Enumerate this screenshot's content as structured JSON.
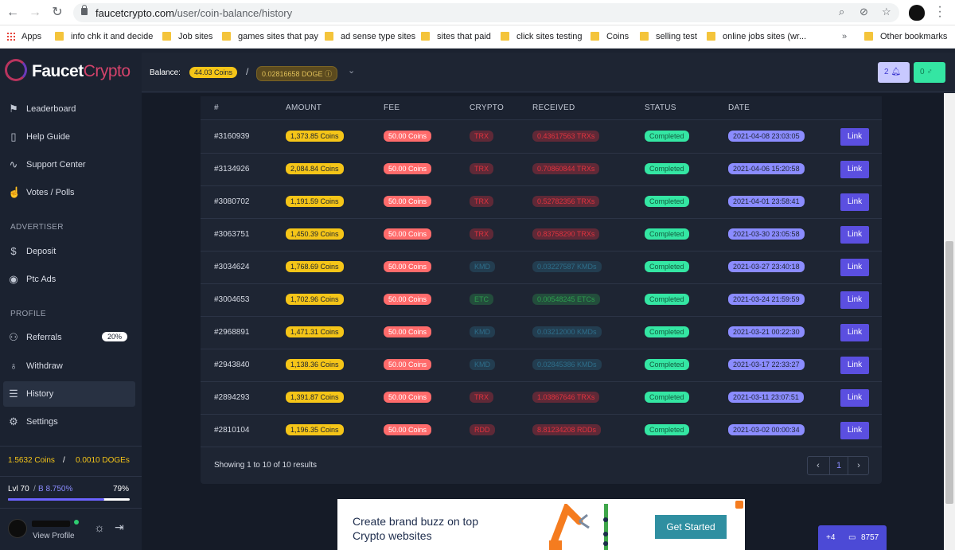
{
  "browser": {
    "url_domain": "faucetcrypto.com",
    "url_path": "/user/coin-balance/history",
    "bookmarks": [
      {
        "label": "Apps",
        "type": "apps"
      },
      {
        "label": "info chk it and decide",
        "type": "folder"
      },
      {
        "label": "Job sites",
        "type": "folder"
      },
      {
        "label": "games sites that pay",
        "type": "folder"
      },
      {
        "label": "ad sense type sites",
        "type": "folder"
      },
      {
        "label": "sites that paid",
        "type": "folder"
      },
      {
        "label": "click sites testing",
        "type": "folder"
      },
      {
        "label": "Coins",
        "type": "folder"
      },
      {
        "label": "selling test",
        "type": "folder"
      },
      {
        "label": "online jobs sites (wr...",
        "type": "folder"
      },
      {
        "label": "Other bookmarks",
        "type": "folder"
      }
    ],
    "more_label": "»"
  },
  "logo": {
    "part1": "Faucet",
    "part2": "Crypto"
  },
  "sidebar": {
    "items": [
      {
        "label": "Leaderboard",
        "icon": "flag-icon"
      },
      {
        "label": "Help Guide",
        "icon": "book-icon"
      },
      {
        "label": "Support Center",
        "icon": "activity-icon"
      },
      {
        "label": "Votes / Polls",
        "icon": "thumbs-up-icon"
      }
    ],
    "advertiser_heading": "ADVERTISER",
    "advertiser_items": [
      {
        "label": "Deposit",
        "icon": "dollar-icon"
      },
      {
        "label": "Ptc Ads",
        "icon": "eye-icon"
      }
    ],
    "profile_heading": "PROFILE",
    "profile_items": [
      {
        "label": "Referrals",
        "icon": "users-icon",
        "badge": "20%"
      },
      {
        "label": "Withdraw",
        "icon": "award-icon"
      },
      {
        "label": "History",
        "icon": "database-icon",
        "active": true
      },
      {
        "label": "Settings",
        "icon": "gear-icon"
      }
    ],
    "coins_text": "1.5632 Coins",
    "coins_sep": "/",
    "doge_text": "0.0010 DOGEs",
    "level_text": "Lvl 70",
    "level_sep": "/",
    "bonus_text": "B 8.750%",
    "level_percent": "79%",
    "level_progress": 0.79,
    "view_profile": "View Profile"
  },
  "topbar": {
    "balance_label": "Balance:",
    "coins_pill": "44.03 Coins",
    "separator": "/",
    "doge_pill": "0.02816658 DOGE",
    "notif_count": "2",
    "msg_count": "0"
  },
  "table": {
    "headers": [
      "#",
      "AMOUNT",
      "FEE",
      "CRYPTO",
      "RECEIVED",
      "STATUS",
      "DATE"
    ],
    "rows": [
      {
        "id": "#3160939",
        "amount": "1,373.85 Coins",
        "fee": "50.00 Coins",
        "crypto": "TRX",
        "received": "0.43617563 TRXs",
        "status": "Completed",
        "date": "2021-04-08 23:03:05",
        "link": "Link",
        "color": "#e0333f"
      },
      {
        "id": "#3134926",
        "amount": "2,084.84 Coins",
        "fee": "50.00 Coins",
        "crypto": "TRX",
        "received": "0.70860844 TRXs",
        "status": "Completed",
        "date": "2021-04-06 15:20:58",
        "link": "Link",
        "color": "#e0333f"
      },
      {
        "id": "#3080702",
        "amount": "1,191.59 Coins",
        "fee": "50.00 Coins",
        "crypto": "TRX",
        "received": "0.52782356 TRXs",
        "status": "Completed",
        "date": "2021-04-01 23:58:41",
        "link": "Link",
        "color": "#e0333f"
      },
      {
        "id": "#3063751",
        "amount": "1,450.39 Coins",
        "fee": "50.00 Coins",
        "crypto": "TRX",
        "received": "0.83758290 TRXs",
        "status": "Completed",
        "date": "2021-03-30 23:05:58",
        "link": "Link",
        "color": "#e0333f"
      },
      {
        "id": "#3034624",
        "amount": "1,768.69 Coins",
        "fee": "50.00 Coins",
        "crypto": "KMD",
        "received": "0.03227587 KMDs",
        "status": "Completed",
        "date": "2021-03-27 23:40:18",
        "link": "Link",
        "color": "#2e6e8a"
      },
      {
        "id": "#3004653",
        "amount": "1,702.96 Coins",
        "fee": "50.00 Coins",
        "crypto": "ETC",
        "received": "0.00548245 ETCs",
        "status": "Completed",
        "date": "2021-03-24 21:59:59",
        "link": "Link",
        "color": "#2e9e4e"
      },
      {
        "id": "#2968891",
        "amount": "1,471.31 Coins",
        "fee": "50.00 Coins",
        "crypto": "KMD",
        "received": "0.03212000 KMDs",
        "status": "Completed",
        "date": "2021-03-21 00:22:30",
        "link": "Link",
        "color": "#2e6e8a"
      },
      {
        "id": "#2943840",
        "amount": "1,138.36 Coins",
        "fee": "50.00 Coins",
        "crypto": "KMD",
        "received": "0.02845386 KMDs",
        "status": "Completed",
        "date": "2021-03-17 22:33:27",
        "link": "Link",
        "color": "#2e6e8a"
      },
      {
        "id": "#2894293",
        "amount": "1,391.87 Coins",
        "fee": "50.00 Coins",
        "crypto": "TRX",
        "received": "1.03867646 TRXs",
        "status": "Completed",
        "date": "2021-03-11 23:07:51",
        "link": "Link",
        "color": "#e0333f"
      },
      {
        "id": "#2810104",
        "amount": "1,196.35 Coins",
        "fee": "50.00 Coins",
        "crypto": "RDD",
        "received": "8.81234208 RDDs",
        "status": "Completed",
        "date": "2021-03-02 00:00:34",
        "link": "Link",
        "color": "#e0333f"
      }
    ],
    "showing_text": "Showing 1 to 10 of 10 results",
    "page": "1",
    "prev": "‹",
    "next": "›"
  },
  "ad": {
    "line1": "Create brand buzz on top",
    "line2": "Crypto websites",
    "cta": "Get Started"
  },
  "chat_widget": {
    "plus": "+4",
    "count": "8757"
  }
}
